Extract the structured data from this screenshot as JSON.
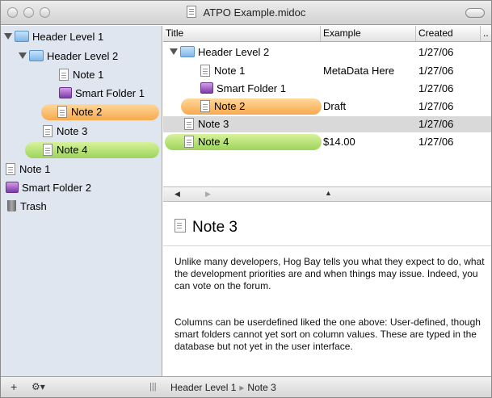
{
  "window": {
    "title": "ATPO Example.midoc"
  },
  "sidebar": {
    "items": [
      {
        "label": "Header Level 1",
        "kind": "folder",
        "expanded": true
      },
      {
        "label": "Header Level 2",
        "kind": "folder",
        "expanded": true
      },
      {
        "label": "Note 1",
        "kind": "note"
      },
      {
        "label": "Smart Folder 1",
        "kind": "smart-folder"
      },
      {
        "label": "Note 2",
        "kind": "note",
        "highlight": "orange"
      },
      {
        "label": "Note 3",
        "kind": "note"
      },
      {
        "label": "Note 4",
        "kind": "note",
        "highlight": "green"
      },
      {
        "label": "Note 1",
        "kind": "note"
      },
      {
        "label": "Smart Folder 2",
        "kind": "smart-folder"
      },
      {
        "label": "Trash",
        "kind": "trash"
      }
    ]
  },
  "table": {
    "columns": [
      "Title",
      "Example",
      "Created",
      ".."
    ],
    "rows": [
      {
        "title": "Header Level 2",
        "example": "",
        "created": "1/27/06"
      },
      {
        "title": "Note 1",
        "example": "MetaData Here",
        "created": "1/27/06"
      },
      {
        "title": "Smart Folder 1",
        "example": "",
        "created": "1/27/06"
      },
      {
        "title": "Note 2",
        "example": "Draft",
        "created": "1/27/06",
        "highlight": "orange"
      },
      {
        "title": "Note 3",
        "example": "",
        "created": "1/27/06",
        "selected": true
      },
      {
        "title": "Note 4",
        "example": "$14.00",
        "created": "1/27/06",
        "highlight": "green"
      }
    ]
  },
  "preview": {
    "title": "Note 3",
    "paragraphs": [
      "Unlike many developers, Hog Bay tells you what they expect to do, what the development priorities are and when things may issue. Indeed, you can vote on the forum.",
      "Columns can be userdefined liked the one above: User-defined, though smart folders cannot yet sort on column values. These are typed in the database but not yet in the user interface."
    ]
  },
  "bottombar": {
    "add_label": "+",
    "gear_label": "⚙▾",
    "grip_label": "|||",
    "breadcrumb": [
      "Header Level 1",
      "Note 3"
    ]
  },
  "colors": {
    "sidebar_bg": "#dfe6ef",
    "highlight_orange": "#f7a94d",
    "highlight_green": "#9dd45a",
    "selection_gray": "#d9d9d9"
  }
}
